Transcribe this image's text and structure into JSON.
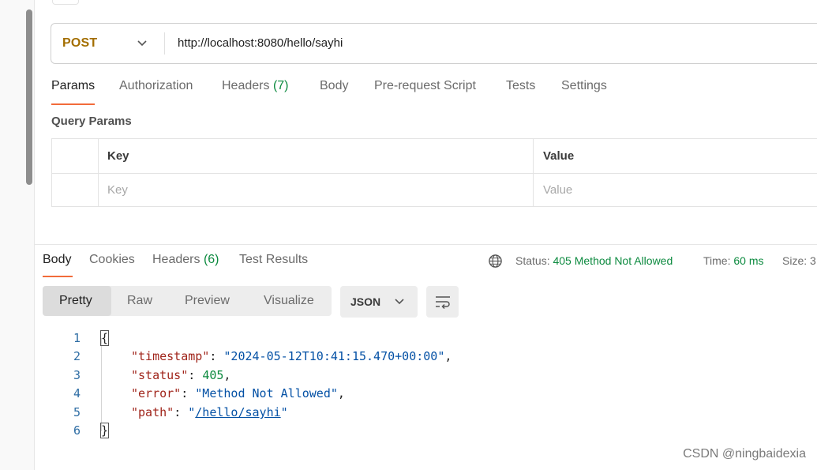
{
  "request": {
    "method": "POST",
    "url": "http://localhost:8080/hello/sayhi",
    "tabs": [
      {
        "label": "Params",
        "count": ""
      },
      {
        "label": "Authorization",
        "count": ""
      },
      {
        "label": "Headers",
        "count": "(7)"
      },
      {
        "label": "Body",
        "count": ""
      },
      {
        "label": "Pre-request Script",
        "count": ""
      },
      {
        "label": "Tests",
        "count": ""
      },
      {
        "label": "Settings",
        "count": ""
      }
    ],
    "query_params": {
      "title": "Query Params",
      "key_header": "Key",
      "value_header": "Value",
      "key_placeholder": "Key",
      "value_placeholder": "Value"
    }
  },
  "response": {
    "tabs": [
      {
        "label": "Body",
        "count": ""
      },
      {
        "label": "Cookies",
        "count": ""
      },
      {
        "label": "Headers",
        "count": "(6)"
      },
      {
        "label": "Test Results",
        "count": ""
      }
    ],
    "status_label": "Status:",
    "status_value": "405 Method Not Allowed",
    "time_label": "Time:",
    "time_value": "60 ms",
    "size_label": "Size: 3",
    "view_modes": [
      "Pretty",
      "Raw",
      "Preview",
      "Visualize"
    ],
    "format": "JSON",
    "line_numbers": [
      "1",
      "2",
      "3",
      "4",
      "5",
      "6"
    ],
    "body": {
      "open": "{",
      "close": "}",
      "timestamp_key": "\"timestamp\"",
      "timestamp_value": "\"2024-05-12T10:41:15.470+00:00\"",
      "status_key": "\"status\"",
      "status_value": "405",
      "error_key": "\"error\"",
      "error_value": "\"Method Not Allowed\"",
      "path_key": "\"path\"",
      "path_quote": "\"",
      "path_value": "/hello/sayhi"
    }
  },
  "watermark": "CSDN @ningbaidexia",
  "colors": {
    "method": "#a36e00",
    "accent": "#f26b3a",
    "success_count": "#0c8a3f",
    "json_key": "#a0251b",
    "json_string": "#0451a5"
  }
}
